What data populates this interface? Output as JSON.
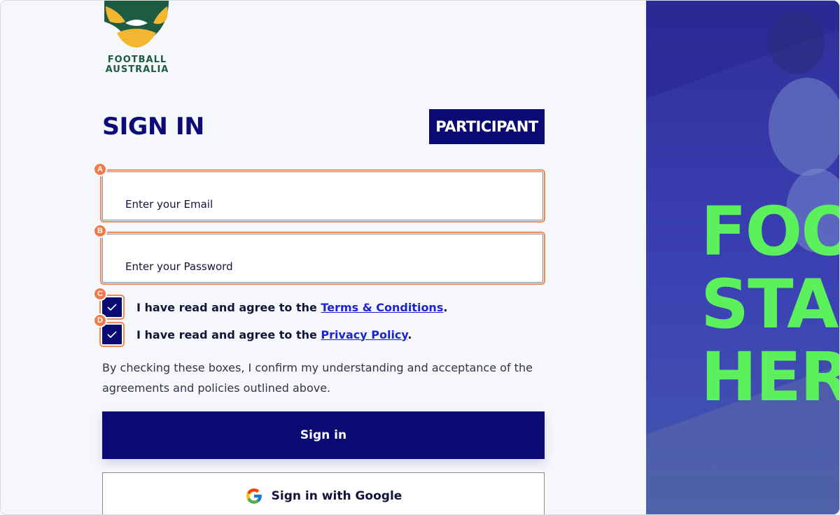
{
  "logo": {
    "line1": "FOOTBALL",
    "line2": "AUSTRALIA"
  },
  "header": {
    "title": "SIGN IN",
    "badge": "PARTICIPANT"
  },
  "form": {
    "email_placeholder": "Enter your Email",
    "password_placeholder": "Enter your Password",
    "terms_prefix": "I have read and agree to the ",
    "terms_link": "Terms & Conditions",
    "terms_suffix": ".",
    "privacy_prefix": "I have read and agree to the ",
    "privacy_link": "Privacy Policy",
    "privacy_suffix": ".",
    "notice": "By checking these boxes, I confirm my understanding and acceptance of the agreements and policies outlined above.",
    "sign_in_label": "Sign in",
    "google_label": "Sign in with Google"
  },
  "markers": {
    "a": "A",
    "b": "B",
    "c": "C",
    "d": "D"
  },
  "hero": {
    "line1": "FOO",
    "line2": "STAR",
    "line3": "HERI"
  },
  "colors": {
    "navy": "#0a0a73",
    "accent_orange": "#f07a4a",
    "hero_green": "#5cf05c",
    "logo_green": "#1d5b43",
    "logo_gold": "#f2b630"
  },
  "icons": {
    "checkbox": "check-icon",
    "google": "google-g-icon",
    "logo": "football-australia-logo"
  }
}
